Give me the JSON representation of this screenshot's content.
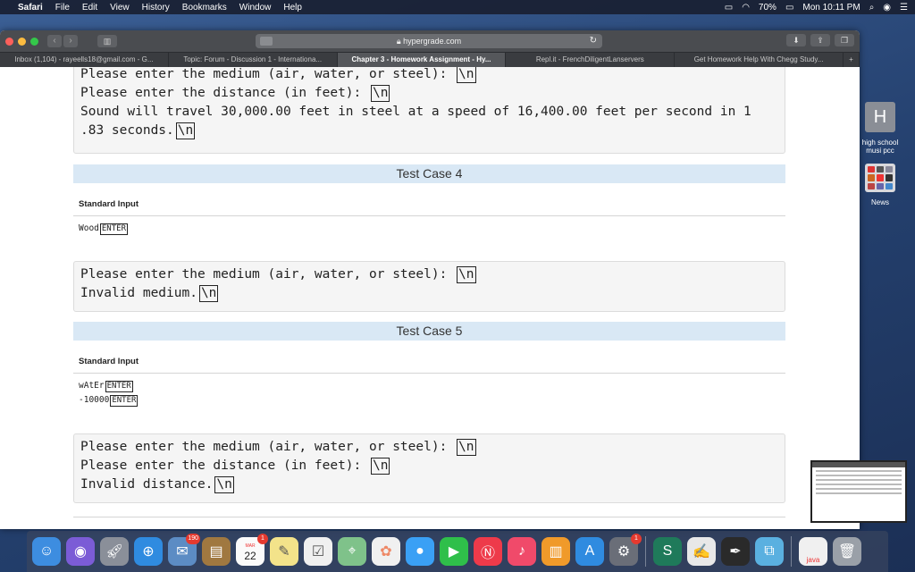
{
  "menubar": {
    "app": "Safari",
    "items": [
      "File",
      "Edit",
      "View",
      "History",
      "Bookmarks",
      "Window",
      "Help"
    ],
    "battery": "70%",
    "clock": "Mon 10:11 PM"
  },
  "browser": {
    "url": "hypergrade.com",
    "tabs": [
      {
        "label": "Inbox (1,104) - rayeells18@gmail.com - G..."
      },
      {
        "label": "Topic: Forum - Discussion 1 - Internationa..."
      },
      {
        "label": "Chapter 3 - Homework Assignment - Hy..."
      },
      {
        "label": "Repl.it - FrenchDiligentLanservers"
      },
      {
        "label": "Get Homework Help With Chegg Study..."
      }
    ],
    "new_tab_symbol": "+"
  },
  "content": {
    "top_output": {
      "lines": [
        "Please enter the medium (air, water, or steel): ",
        "Please enter the distance (in feet): ",
        "Sound will travel 30,000.00 feet in steel at a speed of 16,400.00 feet per second in 1",
        ".83 seconds."
      ],
      "newline_marker": "\\n"
    },
    "test_case_4": {
      "title": "Test Case 4",
      "standard_input_label": "Standard Input",
      "inputs": [
        "Wood"
      ],
      "enter_label": "ENTER",
      "output_lines": [
        "Please enter the medium (air, water, or steel): ",
        "Invalid medium."
      ]
    },
    "test_case_5": {
      "title": "Test Case 5",
      "standard_input_label": "Standard Input",
      "inputs": [
        "wAtEr",
        "-10000"
      ],
      "enter_label": "ENTER",
      "output_lines": [
        "Please enter the medium (air, water, or steel): ",
        "Please enter the distance (in feet): ",
        "Invalid distance."
      ]
    }
  },
  "side_widgets": {
    "h_letter": "H",
    "h_label": "high school musi pcc",
    "news_label": "News"
  },
  "dock": {
    "calendar_month": "MAR",
    "calendar_day": "22",
    "badge_1": "190",
    "badge_2": "1",
    "badge_3": "1",
    "java_label": "java"
  }
}
